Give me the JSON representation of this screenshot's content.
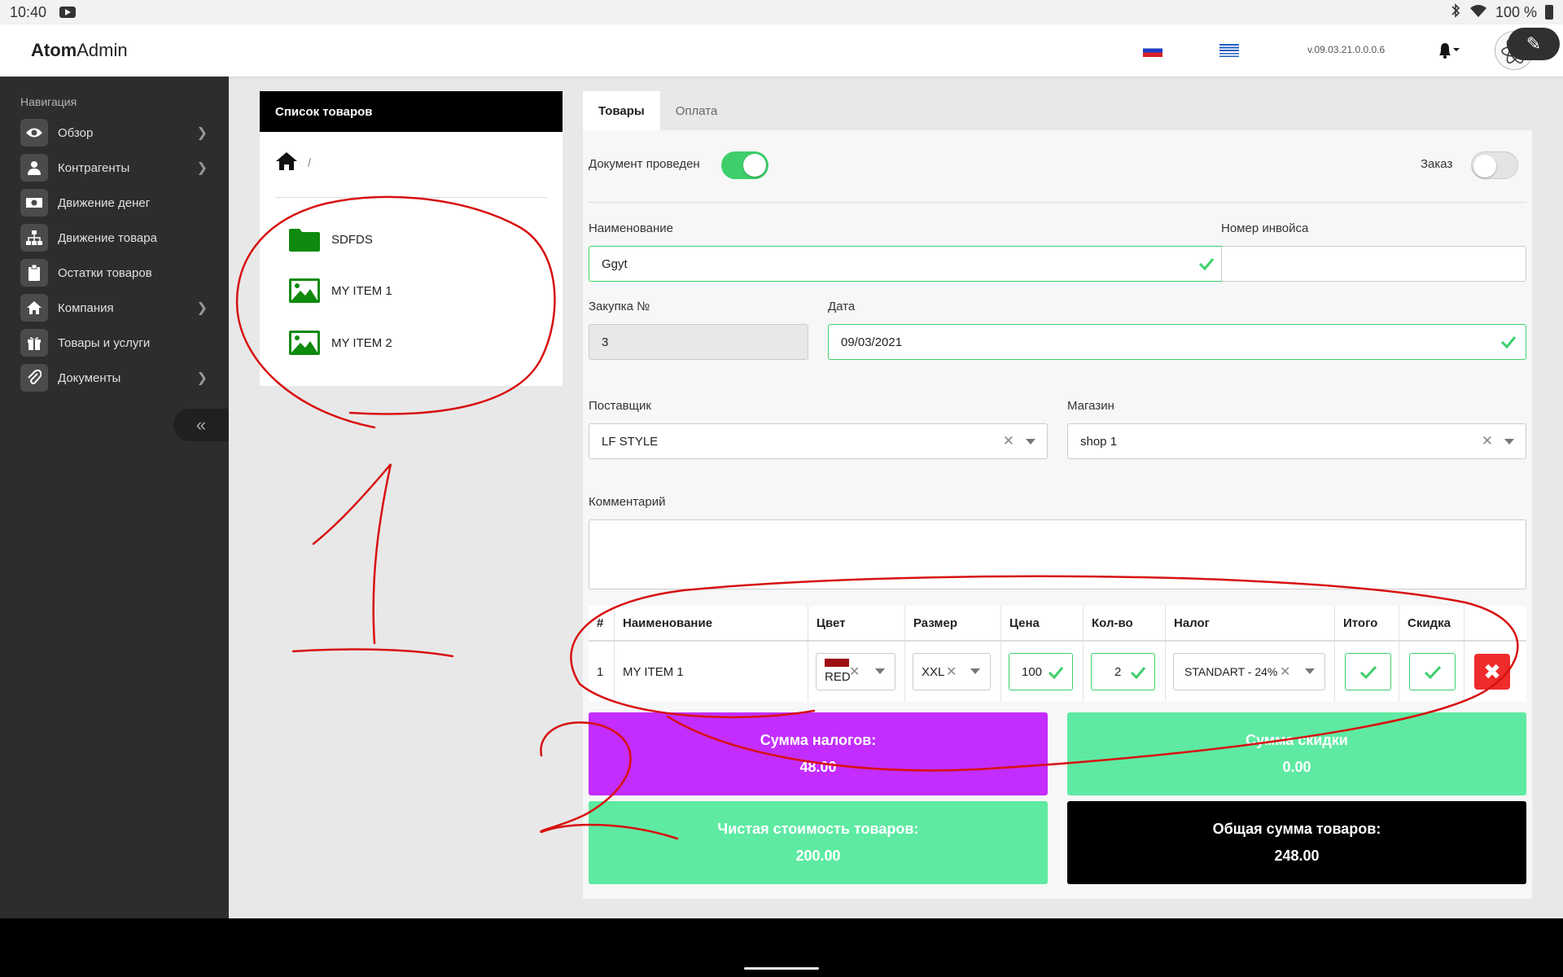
{
  "status_bar": {
    "time": "10:40",
    "battery": "100 %"
  },
  "header": {
    "brand_bold": "Atom",
    "brand_rest": "Admin",
    "version": "v.09.03.21.0.0.0.6"
  },
  "colors": {
    "sidebar_bg": "#2c2d2f",
    "toggle_on": "#3ecf6a",
    "tax_tile": "#c32dff",
    "green_tile": "#5eeaa2",
    "total_tile": "#000000",
    "delete_button": "#ee2c2c",
    "annotation_red": "#d81010"
  },
  "sidebar": {
    "heading": "Навигация",
    "items": [
      {
        "label": "Обзор",
        "icon": "eye-icon",
        "has_submenu": true
      },
      {
        "label": "Контрагенты",
        "icon": "users-icon",
        "has_submenu": true
      },
      {
        "label": "Движение денег",
        "icon": "money-icon",
        "has_submenu": false
      },
      {
        "label": "Движение товара",
        "icon": "sitemap-icon",
        "has_submenu": false
      },
      {
        "label": "Остатки товаров",
        "icon": "clipboard-icon",
        "has_submenu": false
      },
      {
        "label": "Компания",
        "icon": "home-icon",
        "has_submenu": true
      },
      {
        "label": "Товары и услуги",
        "icon": "gift-icon",
        "has_submenu": false
      },
      {
        "label": "Документы",
        "icon": "paperclip-icon",
        "has_submenu": true
      }
    ]
  },
  "product_list": {
    "title": "Список товаров",
    "breadcrumb_sep": "/",
    "items": [
      {
        "label": "SDFDS",
        "icon": "folder-icon"
      },
      {
        "label": "MY ITEM 1",
        "icon": "image-icon"
      },
      {
        "label": "MY ITEM 2",
        "icon": "image-icon"
      }
    ]
  },
  "tabs": [
    {
      "label": "Товары",
      "active": true
    },
    {
      "label": "Оплата",
      "active": false
    }
  ],
  "form": {
    "posted_label": "Документ проведен",
    "posted": true,
    "order_label": "Заказ",
    "order": false,
    "name_label": "Наименование",
    "name_value": "Ggyt",
    "invoice_label": "Номер инвойса",
    "invoice_value": "",
    "purchase_no_label": "Закупка №",
    "purchase_no_value": "3",
    "date_label": "Дата",
    "date_value": "09/03/2021",
    "supplier_label": "Поставщик",
    "supplier_value": "LF STYLE",
    "shop_label": "Магазин",
    "shop_value": "shop 1",
    "comment_label": "Комментарий",
    "comment_value": ""
  },
  "items_table": {
    "headers": [
      "#",
      "Наименование",
      "Цвет",
      "Размер",
      "Цена",
      "Кол-во",
      "Налог",
      "Итого",
      "Скидка"
    ],
    "rows": [
      {
        "num": "1",
        "name": "MY ITEM 1",
        "color": "RED",
        "color_swatch": "#9e0f14",
        "size": "XXL",
        "price": "100",
        "qty": "2",
        "tax": "STANDART - 24%"
      }
    ]
  },
  "totals": {
    "tax_label": "Сумма налогов:",
    "tax_value": "48.00",
    "discount_label": "Сумма скидки",
    "discount_value": "0.00",
    "net_label": "Чистая стоимость товаров:",
    "net_value": "200.00",
    "total_label": "Общая сумма товаров:",
    "total_value": "248.00"
  }
}
